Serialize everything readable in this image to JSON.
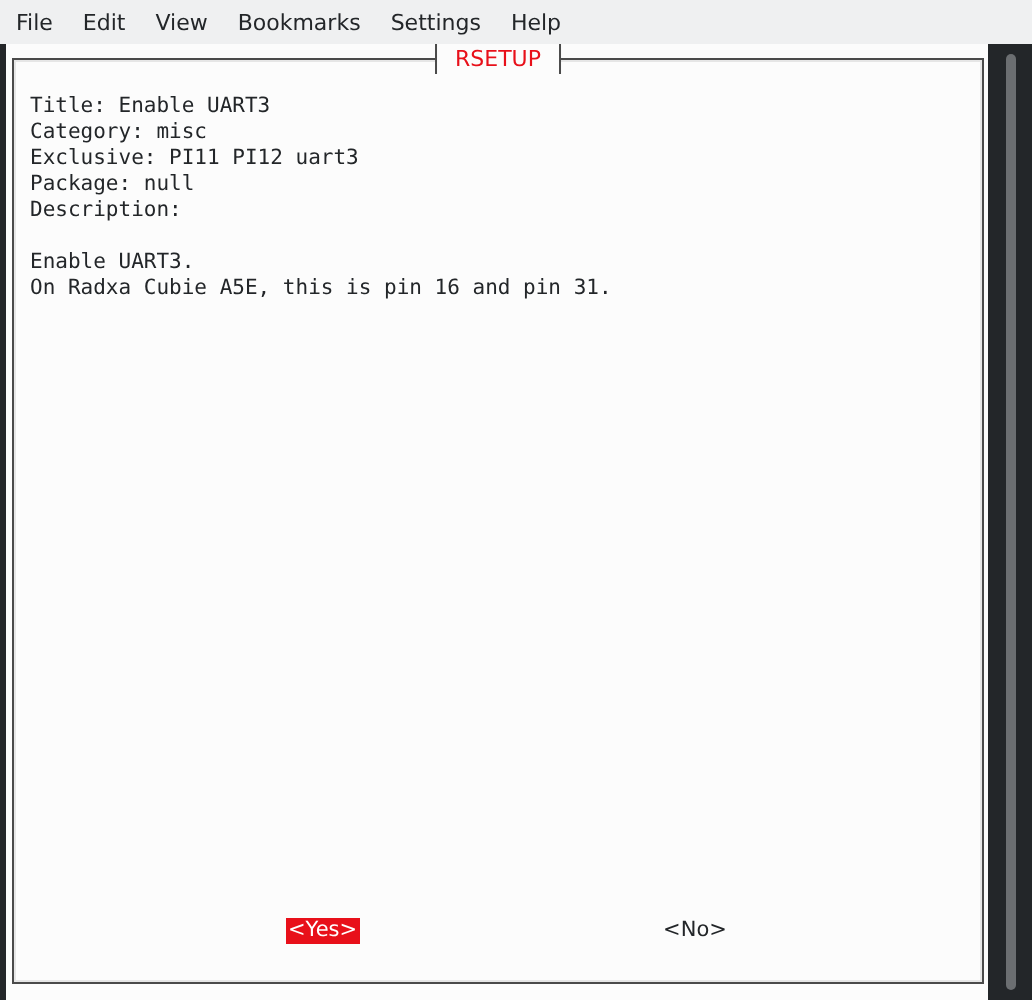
{
  "menu_bar": [
    "File",
    "Edit",
    "View",
    "Bookmarks",
    "Settings",
    "Help"
  ],
  "dialog": {
    "title": "RSETUP",
    "fields": [
      "Title: Enable UART3",
      "Category: misc",
      "Exclusive: PI11 PI12 uart3",
      "Package: null",
      "Description:"
    ],
    "description": [
      "Enable UART3.",
      "On Radxa Cubie A5E, this is pin 16 and pin 31."
    ],
    "buttons": [
      {
        "label": "<Yes>",
        "selected": true
      },
      {
        "label": "<No>",
        "selected": false
      }
    ]
  }
}
